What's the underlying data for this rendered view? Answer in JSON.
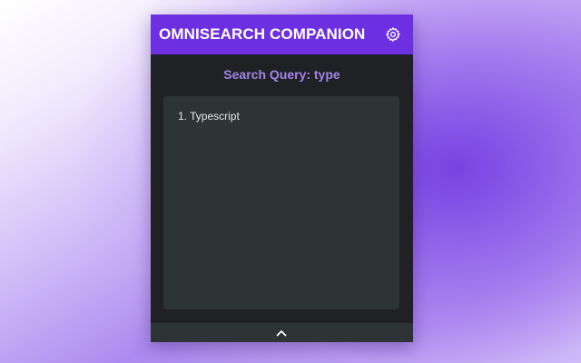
{
  "header": {
    "title": "OMNISEARCH COMPANION",
    "settings_icon": "gear-icon"
  },
  "query": {
    "label": "Search Query: type"
  },
  "results": [
    {
      "label": "1. Typescript"
    }
  ],
  "footer": {
    "toggle_icon": "chevron-up-icon"
  },
  "colors": {
    "header_bg": "#6c2fe1",
    "panel_bg": "#202124",
    "results_bg": "#2e3336",
    "query_text": "#a285ea",
    "title_text": "#ffffff"
  }
}
